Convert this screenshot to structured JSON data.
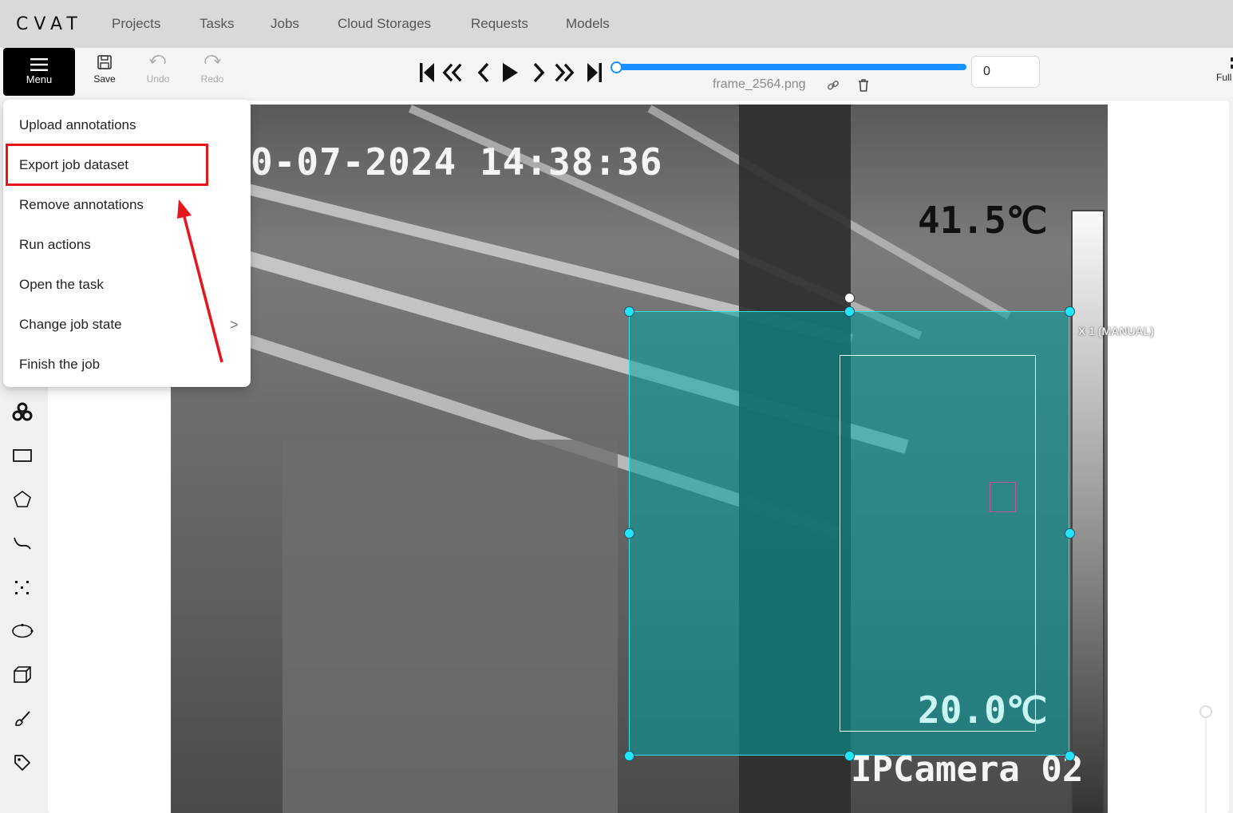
{
  "app": {
    "logo": "CVAT",
    "nav": [
      "Projects",
      "Tasks",
      "Jobs",
      "Cloud Storages",
      "Requests",
      "Models"
    ]
  },
  "toolbar": {
    "menu_label": "Menu",
    "save_label": "Save",
    "undo_label": "Undo",
    "redo_label": "Redo",
    "frame_value": "0",
    "frame_name": "frame_2564.png",
    "fullscreen_label": "Full"
  },
  "menu": {
    "items": [
      "Upload annotations",
      "Export job dataset",
      "Remove annotations",
      "Run actions",
      "Open the task",
      "Change job state",
      "Finish the job"
    ],
    "submenu_chevron": ">"
  },
  "image": {
    "date_overlay": "0-07-2024 14:38:36",
    "temp_high": "41.5℃",
    "temp_low": "20.0℃",
    "camera_label": "IPCamera 02",
    "scale_label": "X 1 (MANUAL)"
  },
  "colors": {
    "accent": "#1890ff",
    "annotation_fill": "#00a0a0",
    "annotation_border": "#2ee6e6",
    "highlight": "#e8141c"
  }
}
